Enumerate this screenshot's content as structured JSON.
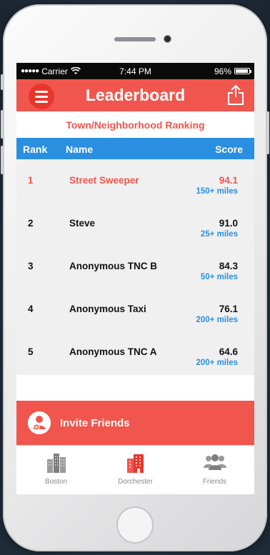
{
  "status_bar": {
    "signal": "●●●●●",
    "carrier": "Carrier",
    "time": "7:44 PM",
    "battery": "96%",
    "battery_level": 0.96
  },
  "nav": {
    "title": "Leaderboard",
    "menu_icon": "hamburger-icon",
    "share_icon": "share-icon"
  },
  "subheader": "Town/Neighborhood Ranking",
  "table": {
    "columns": [
      "Rank",
      "Name",
      "Score"
    ],
    "rows": [
      {
        "rank": "1",
        "name": "Street Sweeper",
        "score": "94.1",
        "miles": "150+ miles"
      },
      {
        "rank": "2",
        "name": "Steve",
        "score": "91.0",
        "miles": "25+ miles"
      },
      {
        "rank": "3",
        "name": "Anonymous TNC B",
        "score": "84.3",
        "miles": "50+ miles"
      },
      {
        "rank": "4",
        "name": "Anonymous Taxi",
        "score": "76.1",
        "miles": "200+ miles"
      },
      {
        "rank": "5",
        "name": "Anonymous TNC A",
        "score": "64.6",
        "miles": "200+ miles"
      }
    ]
  },
  "invite": {
    "label": "Invite Friends",
    "icon": "add-user-icon"
  },
  "tabs": [
    {
      "label": "Boston",
      "icon": "buildings-icon"
    },
    {
      "label": "Dorchester",
      "icon": "building-icon"
    },
    {
      "label": "Friends",
      "icon": "group-icon"
    }
  ],
  "colors": {
    "accent_red": "#f0564d",
    "blue": "#2a8fe0"
  }
}
